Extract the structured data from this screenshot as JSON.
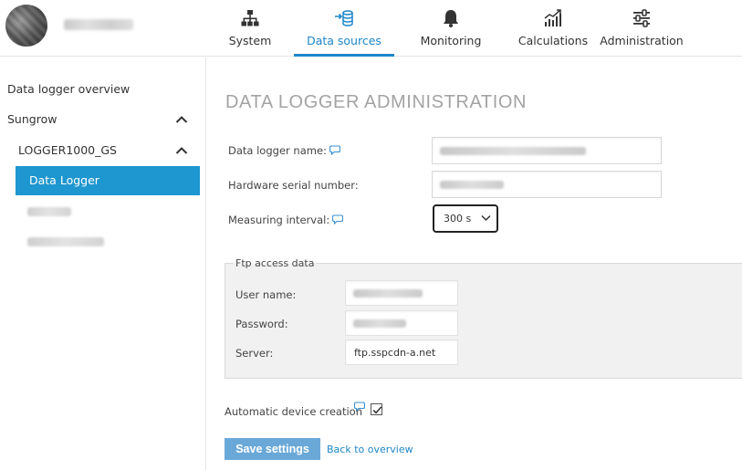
{
  "header": {
    "nav": [
      {
        "label": "System",
        "icon": "hierarchy-icon"
      },
      {
        "label": "Data sources",
        "icon": "database-import-icon",
        "active": true
      },
      {
        "label": "Monitoring",
        "icon": "bell-icon"
      },
      {
        "label": "Calculations",
        "icon": "chart-trend-icon"
      },
      {
        "label": "Administration",
        "icon": "sliders-icon"
      }
    ]
  },
  "sidebar": {
    "items": [
      {
        "label": "Data logger overview"
      },
      {
        "label": "Sungrow"
      },
      {
        "label": "LOGGER1000_GS"
      },
      {
        "label": "Data Logger"
      }
    ]
  },
  "main": {
    "title": "DATA LOGGER ADMINISTRATION",
    "fields": {
      "logger_name_label": "Data logger name:",
      "serial_label": "Hardware serial number:",
      "interval_label": "Measuring interval:",
      "interval_value": "300 s"
    },
    "ftp": {
      "legend": "Ftp access data",
      "username_label": "User name:",
      "password_label": "Password:",
      "server_label": "Server:",
      "server_value": "ftp.sspcdn-a.net"
    },
    "auto_device_label": "Automatic device creation",
    "auto_device_checked": true,
    "save_label": "Save settings",
    "back_label": "Back to overview"
  },
  "colors": {
    "accent": "#1e86c8",
    "active_sidebar": "#1e96cf",
    "button": "#6aa8d8"
  }
}
